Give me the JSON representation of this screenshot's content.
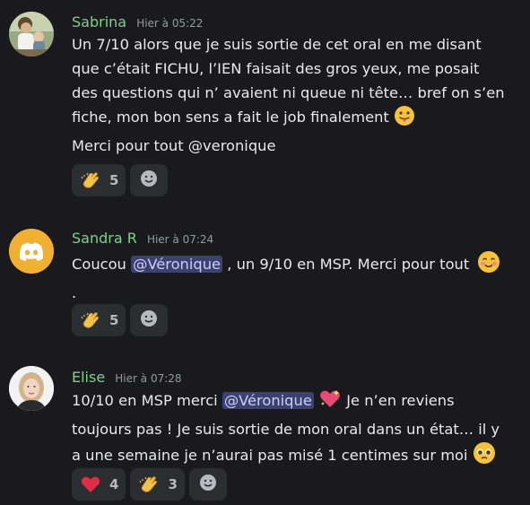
{
  "messages": [
    {
      "author": "Sabrina",
      "timestamp": "Hier à 05:22",
      "lines": [
        "Un 7/10 alors que je suis sortie de cet oral en me disant",
        "que c’était FICHU, l’IEN faisait des gros yeux, me posait",
        "des questions qui n’ avaient ni queue ni tête… bref on s’en",
        "fiche, mon bon sens a fait le job finalement"
      ],
      "last_line": "Merci pour tout @veronique",
      "reactions": [
        {
          "emoji": "clap-emoji",
          "count": "5"
        }
      ]
    },
    {
      "author": "Sandra R",
      "timestamp": "Hier à 07:24",
      "text_before": "Coucou ",
      "mention": "@Véronique",
      "text_after": " , un 9/10 en MSP. Merci pour tout",
      "trailing": ".",
      "reactions": [
        {
          "emoji": "clap-emoji",
          "count": "5"
        }
      ]
    },
    {
      "author": "Elise",
      "timestamp": "Hier à 07:28",
      "text_before": "10/10 en MSP merci ",
      "mention": "@Véronique",
      "text_after": " Je n’en reviens",
      "line2": "toujours pas !  Je suis sortie de mon oral dans un état… il y",
      "line3": "a une semaine je n’aurai pas misé 1 centimes sur moi",
      "reactions": [
        {
          "emoji": "heart-emoji",
          "count": "4"
        },
        {
          "emoji": "clap-emoji",
          "count": "3"
        }
      ]
    }
  ],
  "colors": {
    "background": "#1a1a1e",
    "username": "#7fd08a",
    "mention_bg": "#3c4270",
    "reaction_bg": "#2b2d31",
    "discord_orange": "#f0b132"
  }
}
